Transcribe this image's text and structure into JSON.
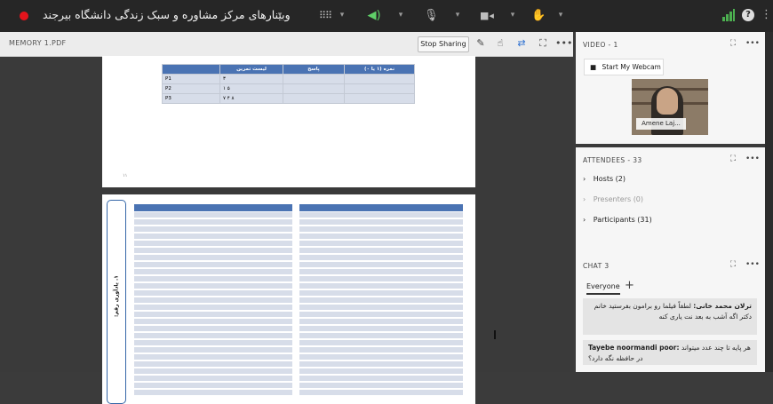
{
  "topbar": {
    "title": "وبینارهای مرکز مشاوره و سبک زندگی دانشگاه بیرجند",
    "icons": [
      "record-icon",
      "apps-icon",
      "speaker-icon",
      "mic-icon",
      "camera-icon",
      "raise-hand-icon",
      "signal-icon",
      "help-icon",
      "more-icon"
    ]
  },
  "share": {
    "label": "MEMORY 1.PDF",
    "stop_label": "Stop Sharing",
    "table": {
      "headers": [
        "",
        "لیست تمرین",
        "پاسخ",
        "نمره (۱ یا ۰)"
      ],
      "rows": [
        [
          "P1",
          "۳",
          "",
          ""
        ],
        [
          "P2",
          "۵   ۱",
          "",
          ""
        ],
        [
          "P3",
          "۸   ۴   ۷",
          "",
          ""
        ]
      ]
    },
    "page_number": "۱۱",
    "page2_label": "۱. یادآوری رقم:"
  },
  "video": {
    "label": "VIDEO",
    "count": "1",
    "webcam_label": "Start My Webcam",
    "participant": "Amene Laj..."
  },
  "attendees": {
    "label": "ATTENDEES",
    "count": "33",
    "hosts": "Hosts (2)",
    "presenters": "Presenters (0)",
    "participants": "Participants (31)"
  },
  "chat": {
    "label": "CHAT",
    "count": "3",
    "tab": "Everyone",
    "messages": [
      {
        "author": "ترلان محمد خانی:",
        "text": "لطفاً فیلما رو برامون بفرستید خانم دکتر اگه آشب به بعد نت یاری کنه"
      },
      {
        "author": "Tayebe noormandi poor:",
        "text": "هر پایه تا چند عدد میتواند در حافظه نگه دارد؟"
      }
    ]
  },
  "colors": {
    "topbar": "#262626",
    "record": "#e3141c",
    "table_header": "#4a73b3",
    "table_row": "#d7dde9",
    "signal": "#4caf50"
  }
}
